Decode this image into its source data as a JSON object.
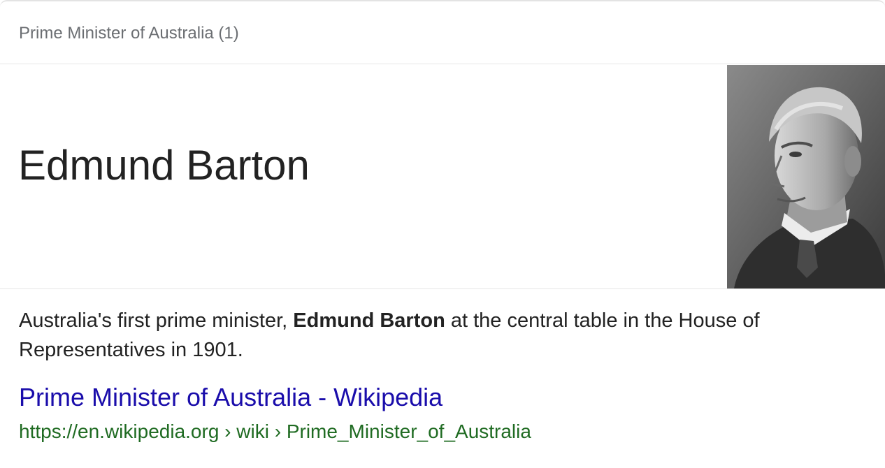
{
  "header": {
    "label": "Prime Minister of Australia (1)"
  },
  "answer": {
    "title": "Edmund Barton",
    "image_icon": "portrait-photo-icon"
  },
  "snippet": {
    "before": "Australia's first prime minister, ",
    "bold": "Edmund Barton",
    "after": " at the central table in the House of Representatives in 1901."
  },
  "result": {
    "title": "Prime Minister of Australia - Wikipedia",
    "url": "https://en.wikipedia.org › wiki › Prime_Minister_of_Australia"
  },
  "colors": {
    "link": "#1a0dab",
    "url": "#1f6b22",
    "text": "#222222",
    "muted": "#6b6e72"
  }
}
